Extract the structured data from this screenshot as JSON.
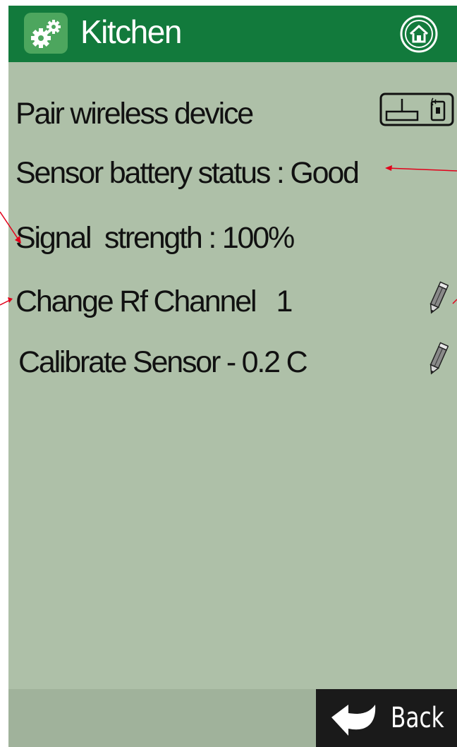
{
  "header": {
    "title": "Kitchen",
    "settings_icon": "gears-icon",
    "home_icon": "home-icon"
  },
  "settings": {
    "pair": {
      "label": "Pair wireless device",
      "icon": "pair-device-icon"
    },
    "battery": {
      "label": "Sensor battery status : Good"
    },
    "signal": {
      "label": "Signal  strength : 100%"
    },
    "rf_channel": {
      "label": "Change Rf Channel   1",
      "icon": "pencil-icon"
    },
    "calibrate": {
      "label": "Calibrate Sensor - 0.2 C",
      "icon": "pencil-icon"
    }
  },
  "footer": {
    "back_label": "Back",
    "back_icon": "back-arrow-icon"
  },
  "colors": {
    "header_green": "#127a3c",
    "body_background": "#aec0a8",
    "annotation_red": "#e2001a"
  }
}
